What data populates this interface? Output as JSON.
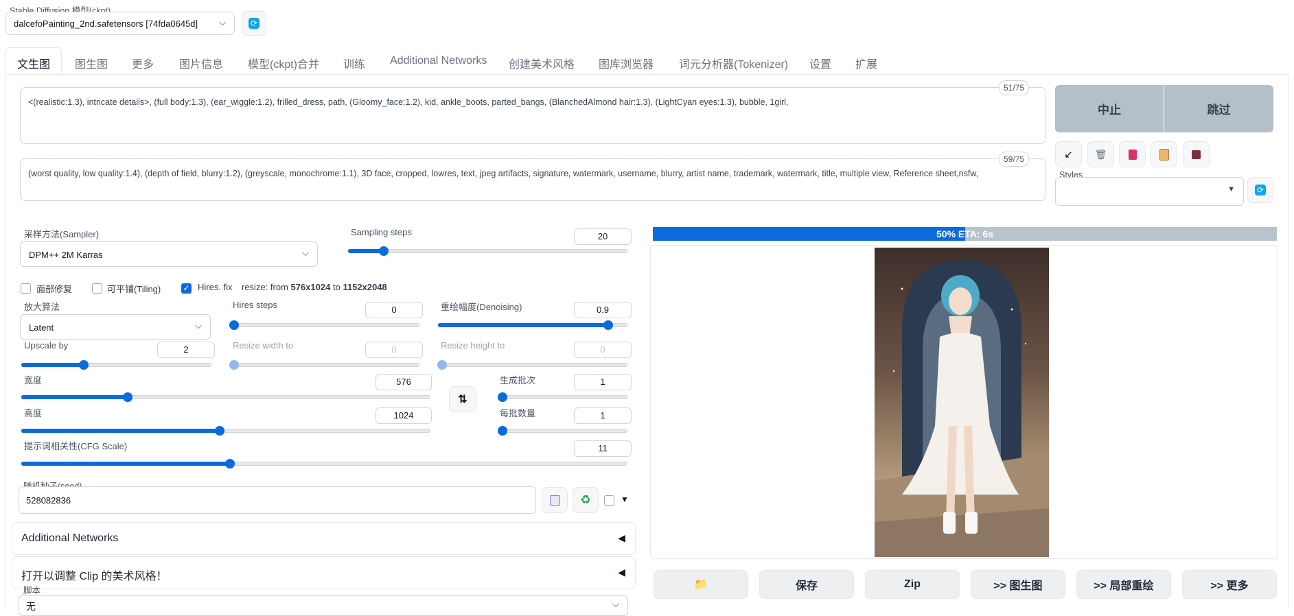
{
  "model": {
    "label": "Stable Diffusion 模型(ckpt)",
    "value": "dalcefoPainting_2nd.safetensors [74fda0645d]"
  },
  "tabs": [
    "文生图",
    "图生图",
    "更多",
    "图片信息",
    "模型(ckpt)合并",
    "训练",
    "Additional Networks",
    "创建美术风格",
    "图库浏览器",
    "词元分析器(Tokenizer)",
    "设置",
    "扩展"
  ],
  "prompt": {
    "positive": "<(realistic:1.3), intricate details>, (full body:1.3), (ear_wiggle:1.2), frilled_dress, path, (Gloomy_face:1.2), kid, ankle_boots, parted_bangs, (BlanchedAlmond hair:1.3), (LightCyan eyes:1.3), bubble, 1girl,",
    "positive_count": "51/75",
    "negative": "(worst quality, low quality:1.4), (depth of field, blurry:1.2), (greyscale, monochrome:1.1), 3D face, cropped, lowres, text, jpeg artifacts, signature, watermark, username, blurry, artist name, trademark, watermark, title, multiple view, Reference sheet,nsfw,",
    "negative_count": "59/75"
  },
  "actions": {
    "interrupt": "中止",
    "skip": "跳过"
  },
  "tool_icons": [
    "arrow-icon",
    "trash-icon",
    "card-icon",
    "clipboard-icon",
    "save-icon"
  ],
  "styles": {
    "label": "Styles",
    "value": ""
  },
  "sampler": {
    "label": "采样方法(Sampler)",
    "value": "DPM++ 2M Karras"
  },
  "steps": {
    "label": "Sampling steps",
    "value": "20",
    "min": 1,
    "max": 150,
    "current": 20
  },
  "checks": {
    "face": {
      "label": "面部修复",
      "checked": false
    },
    "tiling": {
      "label": "可平铺(Tiling)",
      "checked": false
    },
    "hires": {
      "label": "Hires. fix",
      "checked": true
    }
  },
  "resize_info": {
    "prefix": "resize: from ",
    "from": "576x1024",
    "to_word": " to ",
    "to": "1152x2048"
  },
  "upscaler": {
    "label": "放大算法",
    "value": "Latent"
  },
  "hires_steps": {
    "label": "Hires steps",
    "value": "0",
    "fraction": 0.0
  },
  "denoising": {
    "label": "重绘幅度(Denoising)",
    "value": "0.9",
    "fraction": 0.9
  },
  "upscale_by": {
    "label": "Upscale by",
    "value": "2",
    "fraction": 0.33
  },
  "resize_width": {
    "label": "Resize width to",
    "value": "0",
    "fraction": 0.0
  },
  "resize_height": {
    "label": "Resize height to",
    "value": "0",
    "fraction": 0.0
  },
  "width": {
    "label": "宽度",
    "value": "576",
    "fraction": 0.26
  },
  "height": {
    "label": "高度",
    "value": "1024",
    "fraction": 0.485
  },
  "batch_count": {
    "label": "生成批次",
    "value": "1",
    "fraction": 0.0
  },
  "batch_size": {
    "label": "每批数量",
    "value": "1",
    "fraction": 0.0
  },
  "cfg": {
    "label": "提示词相关性(CFG Scale)",
    "value": "11",
    "fraction": 0.345
  },
  "seed": {
    "label": "随机种子(seed)",
    "value": "528082836"
  },
  "accordions": {
    "networks": "Additional Networks",
    "clip": "打开以调整 Clip 的美术风格！"
  },
  "script": {
    "label": "脚本",
    "value": "无"
  },
  "progress": {
    "text": "50% ETA: 6s",
    "fraction": 0.5
  },
  "gallery_buttons": [
    "📁",
    "保存",
    "Zip",
    ">> 图生图",
    ">> 局部重绘",
    ">> 更多"
  ],
  "colors": {
    "accent": "#0b6bdc",
    "progress_bg": "#b9c3ce",
    "action_bg": "#b5bfc9"
  }
}
